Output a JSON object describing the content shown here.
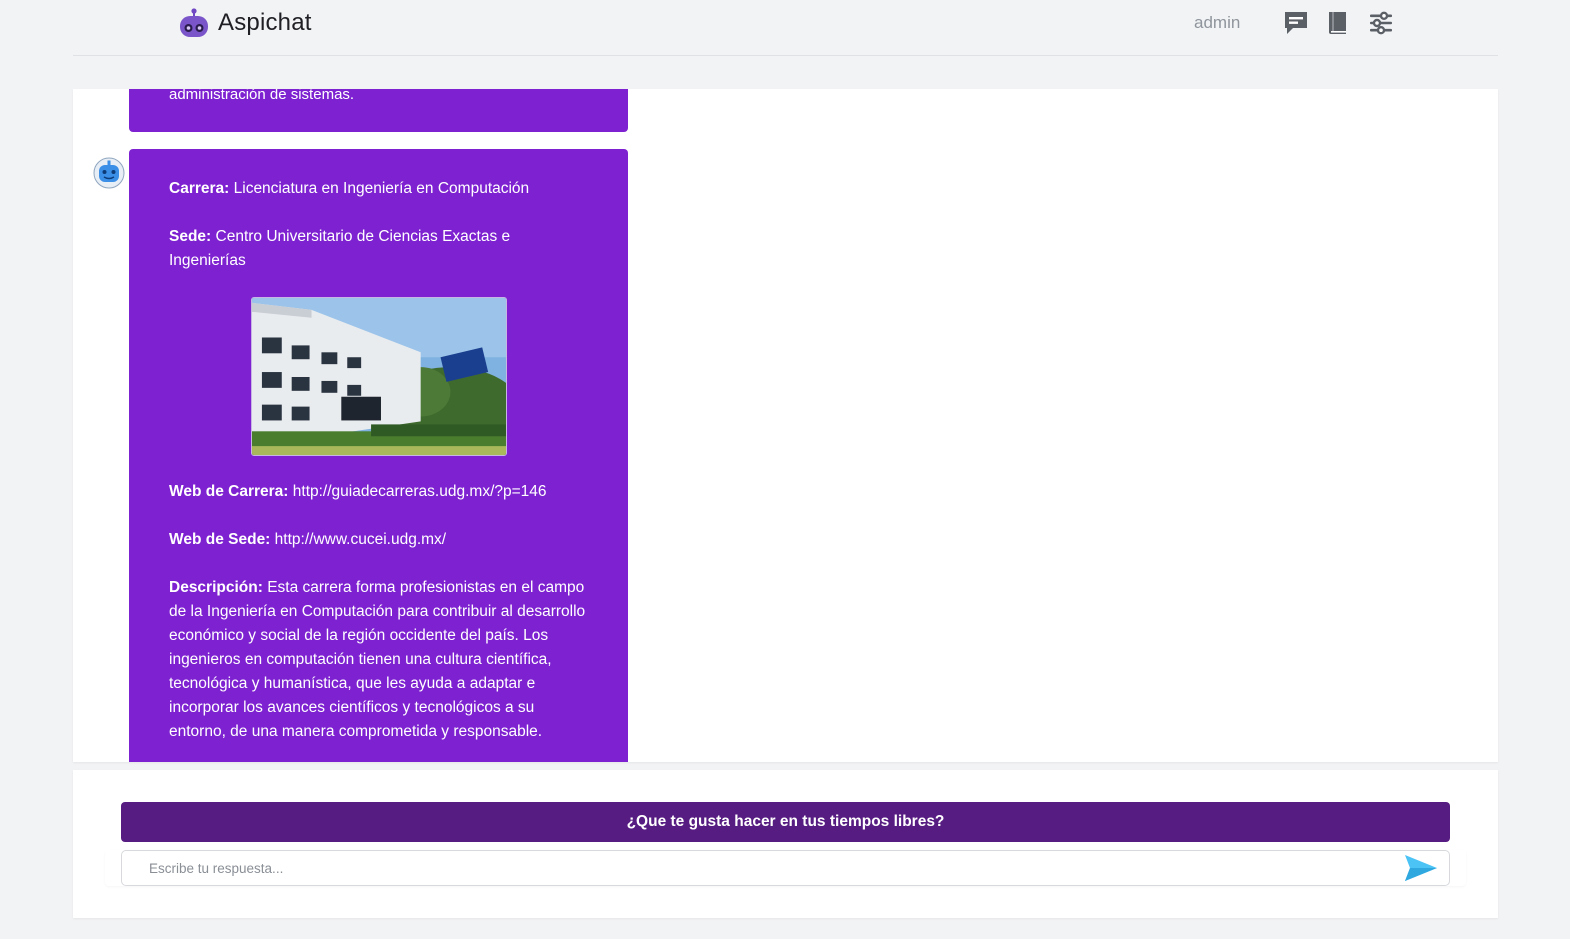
{
  "app": {
    "title": "Aspichat"
  },
  "header": {
    "username": "admin",
    "icons": [
      "chat-bubble-icon",
      "book-icon",
      "settings-sliders-icon"
    ]
  },
  "chat": {
    "previous_message_tail": "administración de sistemas.",
    "message": {
      "carrera_label": "Carrera:",
      "carrera_value": "Licenciatura en Ingeniería en Computación",
      "sede_label": "Sede:",
      "sede_value": "Centro Universitario de Ciencias Exactas e Ingenierías",
      "web_carrera_label": "Web de Carrera:",
      "web_carrera_value": "http://guiadecarreras.udg.mx/?p=146",
      "web_sede_label": "Web de Sede:",
      "web_sede_value": "http://www.cucei.udg.mx/",
      "descripcion_label": "Descripción:",
      "descripcion_value": "Esta carrera forma profesionistas en el campo de la Ingeniería en Computación para contribuir al desarrollo económico y social de la región occidente del país. Los ingenieros en computación tienen una cultura científica, tecnológica y humanística, que les ayuda a adaptar e incorporar los avances científicos y tecnológicos a su entorno, de una manera comprometida y responsable."
    }
  },
  "prompt": {
    "question": "¿Que te gusta hacer en tus tiempos libres?",
    "input_placeholder": "Escribe tu respuesta...",
    "input_value": ""
  },
  "colors": {
    "bubble": "#7e22d1",
    "question_bar": "#561c82",
    "send_icon": "#4cc3f5",
    "page_bg": "#f2f3f5"
  }
}
